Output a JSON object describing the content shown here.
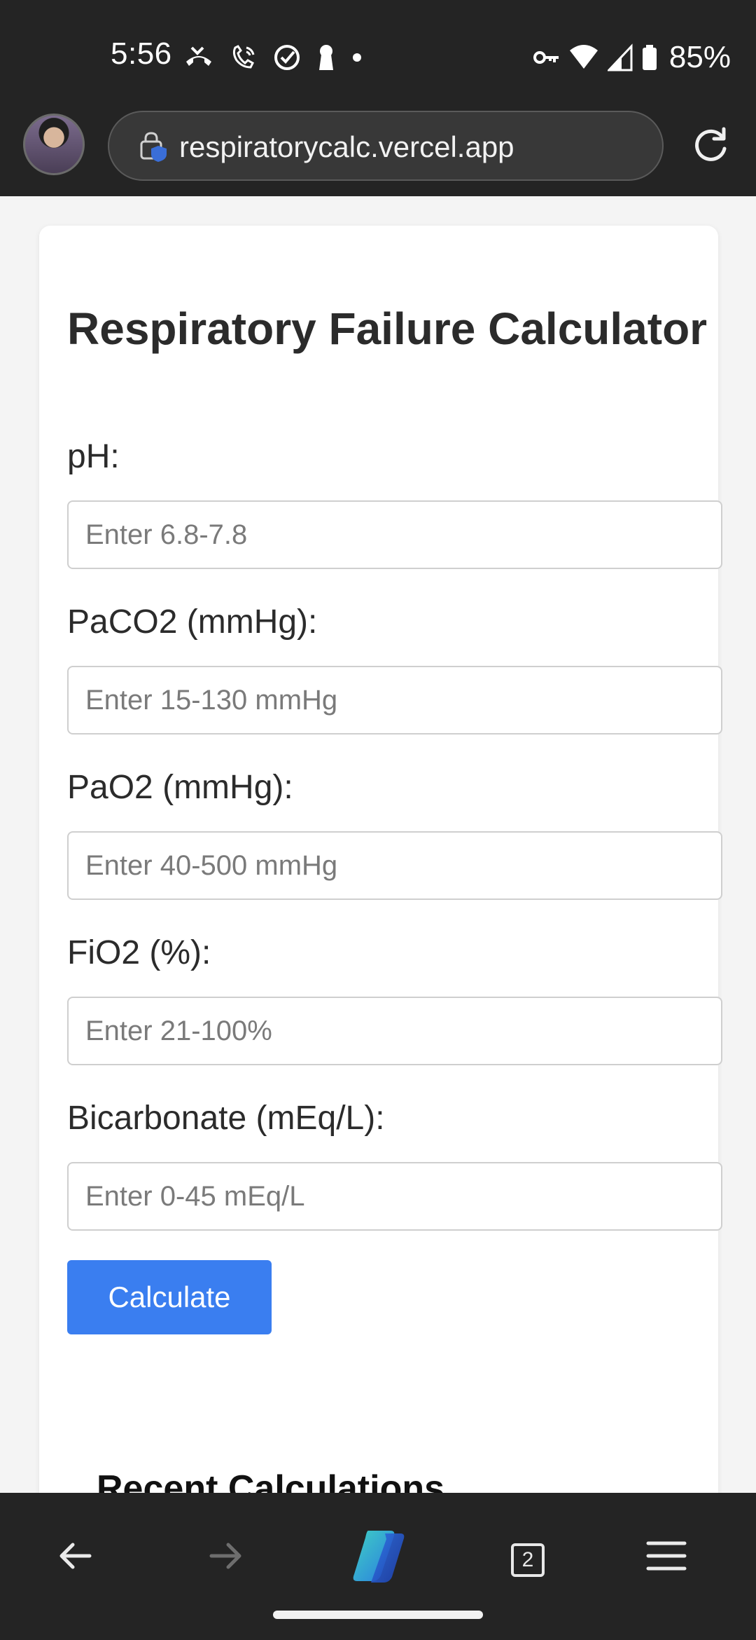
{
  "status_bar": {
    "time": "5:56",
    "battery": "85%"
  },
  "browser": {
    "url": "respiratorycalc.vercel.app",
    "tab_count": "2"
  },
  "calculator": {
    "title": "Respiratory Failure Calculator",
    "fields": [
      {
        "label": "pH:",
        "placeholder": "Enter 6.8-7.8"
      },
      {
        "label": "PaCO2 (mmHg):",
        "placeholder": "Enter 15-130 mmHg"
      },
      {
        "label": "PaO2 (mmHg):",
        "placeholder": "Enter 40-500 mmHg"
      },
      {
        "label": "FiO2 (%):",
        "placeholder": "Enter 21-100%"
      },
      {
        "label": "Bicarbonate (mEq/L):",
        "placeholder": "Enter 0-45 mEq/L"
      }
    ],
    "button_label": "Calculate",
    "recent_title": "Recent Calculations"
  },
  "colors": {
    "accent": "#3a7ef0",
    "chrome_bg": "#242424"
  }
}
